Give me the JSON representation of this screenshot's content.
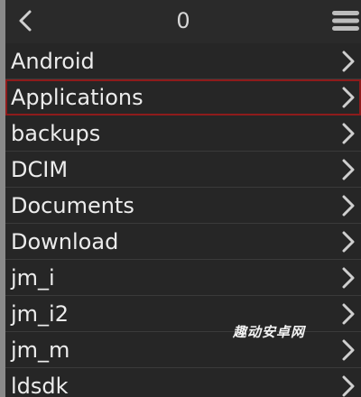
{
  "header": {
    "title": "0"
  },
  "icons": {
    "back": "chevron-left-icon",
    "menu": "hamburger-menu-icon",
    "row_chevron": "chevron-right-icon"
  },
  "colors": {
    "background": "#262626",
    "selection_border": "#8e1b1b",
    "left_bar": "#8a8a8a"
  },
  "list": {
    "selected_index": 1,
    "items": [
      {
        "label": "Android"
      },
      {
        "label": "Applications"
      },
      {
        "label": "backups"
      },
      {
        "label": "DCIM"
      },
      {
        "label": "Documents"
      },
      {
        "label": "Download"
      },
      {
        "label": "jm_i"
      },
      {
        "label": "jm_i2"
      },
      {
        "label": "jm_m"
      },
      {
        "label": "ldsdk"
      }
    ]
  },
  "watermark": {
    "text": "趣动安卓网"
  }
}
